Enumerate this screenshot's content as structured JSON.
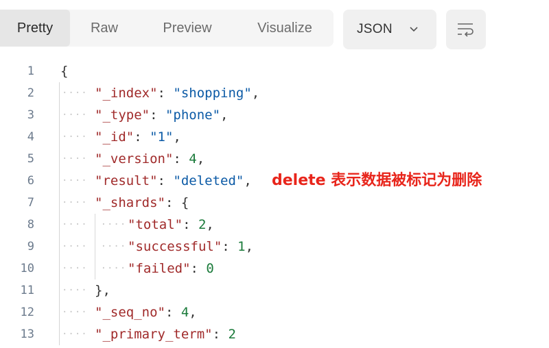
{
  "toolbar": {
    "tabs": [
      {
        "label": "Pretty",
        "active": true
      },
      {
        "label": "Raw",
        "active": false
      },
      {
        "label": "Preview",
        "active": false
      },
      {
        "label": "Visualize",
        "active": false
      }
    ],
    "format_label": "JSON",
    "chevron_icon": "chevron-down-icon",
    "wrap_icon": "wrap-lines-icon"
  },
  "code": {
    "lines": [
      {
        "n": "1",
        "parts": [
          {
            "c": "p",
            "t": "{"
          }
        ]
      },
      {
        "n": "2",
        "parts": [
          {
            "c": "k",
            "t": "\"_index\""
          },
          {
            "c": "p",
            "t": ": "
          },
          {
            "c": "s",
            "t": "\"shopping\""
          },
          {
            "c": "p",
            "t": ","
          }
        ]
      },
      {
        "n": "3",
        "parts": [
          {
            "c": "k",
            "t": "\"_type\""
          },
          {
            "c": "p",
            "t": ": "
          },
          {
            "c": "s",
            "t": "\"phone\""
          },
          {
            "c": "p",
            "t": ","
          }
        ]
      },
      {
        "n": "4",
        "parts": [
          {
            "c": "k",
            "t": "\"_id\""
          },
          {
            "c": "p",
            "t": ": "
          },
          {
            "c": "s",
            "t": "\"1\""
          },
          {
            "c": "p",
            "t": ","
          }
        ]
      },
      {
        "n": "5",
        "parts": [
          {
            "c": "k",
            "t": "\"_version\""
          },
          {
            "c": "p",
            "t": ": "
          },
          {
            "c": "n",
            "t": "4"
          },
          {
            "c": "p",
            "t": ","
          }
        ]
      },
      {
        "n": "6",
        "parts": [
          {
            "c": "k",
            "t": "\"result\""
          },
          {
            "c": "p",
            "t": ": "
          },
          {
            "c": "s",
            "t": "\"deleted\""
          },
          {
            "c": "p",
            "t": ","
          }
        ]
      },
      {
        "n": "7",
        "parts": [
          {
            "c": "k",
            "t": "\"_shards\""
          },
          {
            "c": "p",
            "t": ": {"
          }
        ]
      },
      {
        "n": "8",
        "parts": [
          {
            "c": "k",
            "t": "\"total\""
          },
          {
            "c": "p",
            "t": ": "
          },
          {
            "c": "n",
            "t": "2"
          },
          {
            "c": "p",
            "t": ","
          }
        ]
      },
      {
        "n": "9",
        "parts": [
          {
            "c": "k",
            "t": "\"successful\""
          },
          {
            "c": "p",
            "t": ": "
          },
          {
            "c": "n",
            "t": "1"
          },
          {
            "c": "p",
            "t": ","
          }
        ]
      },
      {
        "n": "10",
        "parts": [
          {
            "c": "k",
            "t": "\"failed\""
          },
          {
            "c": "p",
            "t": ": "
          },
          {
            "c": "n",
            "t": "0"
          }
        ]
      },
      {
        "n": "11",
        "parts": [
          {
            "c": "p",
            "t": "},"
          }
        ]
      },
      {
        "n": "12",
        "parts": [
          {
            "c": "k",
            "t": "\"_seq_no\""
          },
          {
            "c": "p",
            "t": ": "
          },
          {
            "c": "n",
            "t": "4"
          },
          {
            "c": "p",
            "t": ","
          }
        ]
      },
      {
        "n": "13",
        "parts": [
          {
            "c": "k",
            "t": "\"_primary_term\""
          },
          {
            "c": "p",
            "t": ": "
          },
          {
            "c": "n",
            "t": "2"
          }
        ]
      }
    ]
  },
  "annotation": {
    "text": "delete 表示数据被标记为删除",
    "color": "#e8251b"
  },
  "colors": {
    "key": "#a02a2a",
    "string": "#0b5aa6",
    "number": "#1a7a3a"
  }
}
